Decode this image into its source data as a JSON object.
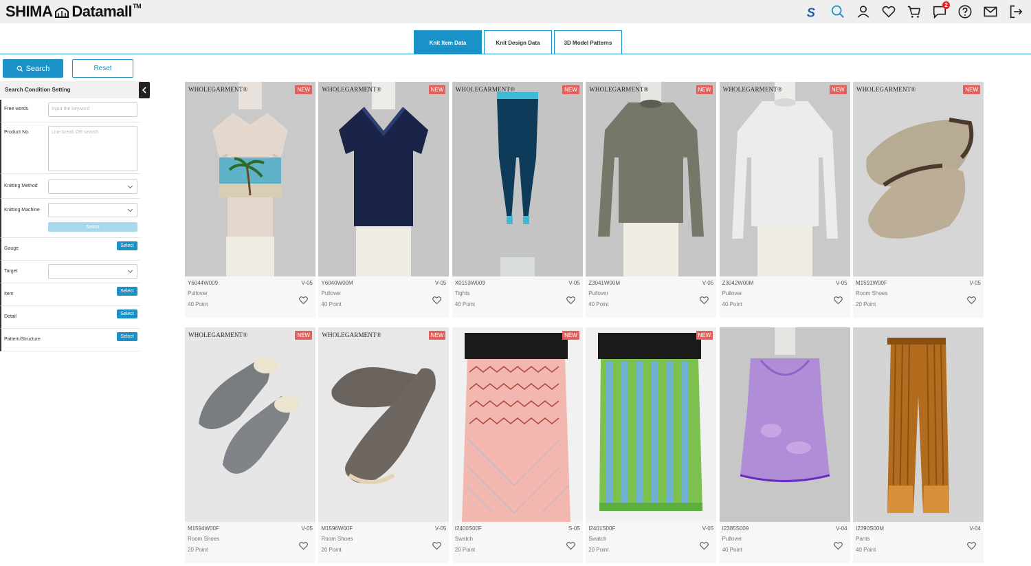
{
  "header": {
    "logo_left": "SHIMA",
    "logo_right": "Datamall",
    "logo_tm": "TM",
    "message_badge": "2"
  },
  "tabs": [
    {
      "label": "Knit Item Data",
      "active": true
    },
    {
      "label": "Knit Design Data",
      "active": false
    },
    {
      "label": "3D Model Patterns",
      "active": false
    }
  ],
  "sidebar": {
    "search_label": "Search",
    "reset_label": "Reset",
    "condition_title": "Search Condition Setting",
    "free_words": {
      "label": "Free words",
      "placeholder": "Input the keyword"
    },
    "product_no": {
      "label": "Product No.",
      "placeholder": "Line break OR search"
    },
    "knitting_method": {
      "label": "Knitting Method"
    },
    "knitting_machine": {
      "label": "Knitting Machine"
    },
    "machine_select_label": "Select",
    "gauge": {
      "label": "Gauge",
      "button": "Select"
    },
    "target": {
      "label": "Target"
    },
    "item": {
      "label": "Item",
      "button": "Select"
    },
    "detail": {
      "label": "Detail",
      "button": "Select"
    },
    "pattern": {
      "label": "Pattern/Structure",
      "button": "Select"
    }
  },
  "watermark": "WHOLEGARMENT®",
  "new_label": "NEW",
  "products": [
    {
      "code": "Y6044W009",
      "version": "V-05",
      "type": "Pullover",
      "points": "40 Point",
      "visual": "tee"
    },
    {
      "code": "Y6040W00M",
      "version": "V-05",
      "type": "Pullover",
      "points": "40 Point",
      "visual": "navy-polo"
    },
    {
      "code": "X0153W009",
      "version": "V-05",
      "type": "Tights",
      "points": "40 Point",
      "visual": "tights"
    },
    {
      "code": "Z3041W00M",
      "version": "V-05",
      "type": "Pullover",
      "points": "40 Point",
      "visual": "gray-sweater"
    },
    {
      "code": "Z3042W00M",
      "version": "V-05",
      "type": "Pullover",
      "points": "40 Point",
      "visual": "white-sweater"
    },
    {
      "code": "M1591W00F",
      "version": "V-05",
      "type": "Room Shoes",
      "points": "20 Point",
      "visual": "beige-shoes"
    },
    {
      "code": "M1594W00F",
      "version": "V-05",
      "type": "Room Shoes",
      "points": "20 Point",
      "visual": "gray-shoes"
    },
    {
      "code": "M1596W00F",
      "version": "V-05",
      "type": "Room Shoes",
      "points": "20 Point",
      "visual": "brown-shoes"
    },
    {
      "code": "I2400S00F",
      "version": "S-05",
      "type": "Swatch",
      "points": "20 Point",
      "visual": "pink-swatch"
    },
    {
      "code": "I2401S00F",
      "version": "V-05",
      "type": "Swatch",
      "points": "20 Point",
      "visual": "green-swatch"
    },
    {
      "code": "I2385S009",
      "version": "V-04",
      "type": "Pullover",
      "points": "40 Point",
      "visual": "purple-top"
    },
    {
      "code": "I2390S00M",
      "version": "V-04",
      "type": "Pants",
      "points": "40 Point",
      "visual": "orange-pants"
    }
  ],
  "colors": {
    "accent": "#1b92c7",
    "new_badge": "#e3615c",
    "badge": "#e02424"
  }
}
